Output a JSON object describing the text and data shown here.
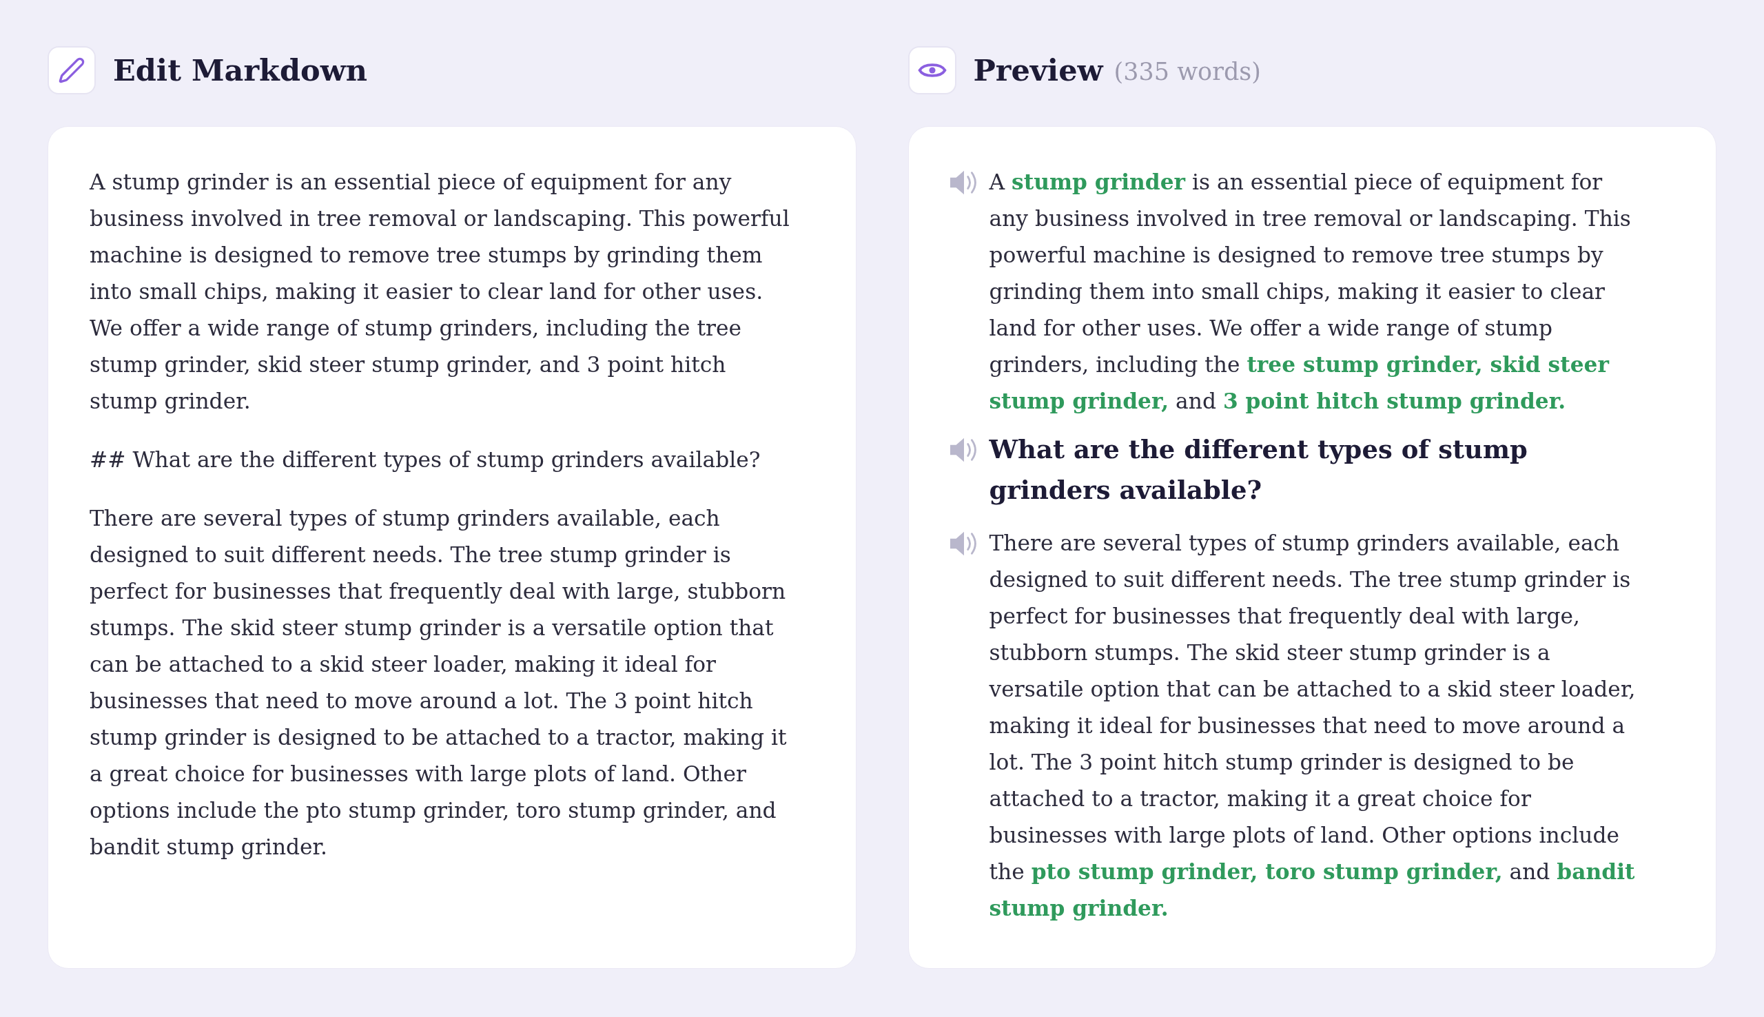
{
  "editor": {
    "title": "Edit Markdown",
    "paragraphs": [
      "A stump grinder is an essential piece of equipment for any business involved in tree removal or landscaping. This powerful machine is designed to remove tree stumps by grinding them into small chips, making it easier to clear land for other uses. We offer a wide range of stump grinders, including the tree stump grinder, skid steer stump grinder, and 3 point hitch stump grinder.",
      "## What are the different types of stump grinders available?",
      "There are several types of stump grinders available, each designed to suit different needs. The tree stump grinder is perfect for businesses that frequently deal with large, stubborn stumps. The skid steer stump grinder is a versatile option that can be attached to a skid steer loader, making it ideal for businesses that need to move around a lot. The 3 point hitch stump grinder is designed to be attached to a tractor, making it a great choice for businesses with large plots of land. Other options include the pto stump grinder, toro stump grinder, and bandit stump grinder."
    ]
  },
  "preview": {
    "title": "Preview",
    "word_count": "(335 words)",
    "blocks": [
      {
        "kind": "paragraph",
        "text": "A **stump grinder** is an essential piece of equipment for any business involved in tree removal or landscaping. This powerful machine is designed to remove tree stumps by grinding them into small chips, making it easier to clear land for other uses. We offer a wide range of stump grinders, including the **tree stump grinder, skid steer stump grinder,** and **3 point hitch stump grinder.**"
      },
      {
        "kind": "heading",
        "text": "What are the different types of stump grinders available?"
      },
      {
        "kind": "paragraph",
        "text": "There are several types of stump grinders available, each designed to suit different needs. The tree stump grinder is perfect for businesses that frequently deal with large, stubborn stumps. The skid steer stump grinder is a versatile option that can be attached to a skid steer loader, making it ideal for businesses that need to move around a lot. The 3 point hitch stump grinder is designed to be attached to a tractor, making it a great choice for businesses with large plots of land. Other options include the **pto stump grinder, toro stump grinder,** and **bandit stump grinder.**"
      }
    ]
  }
}
